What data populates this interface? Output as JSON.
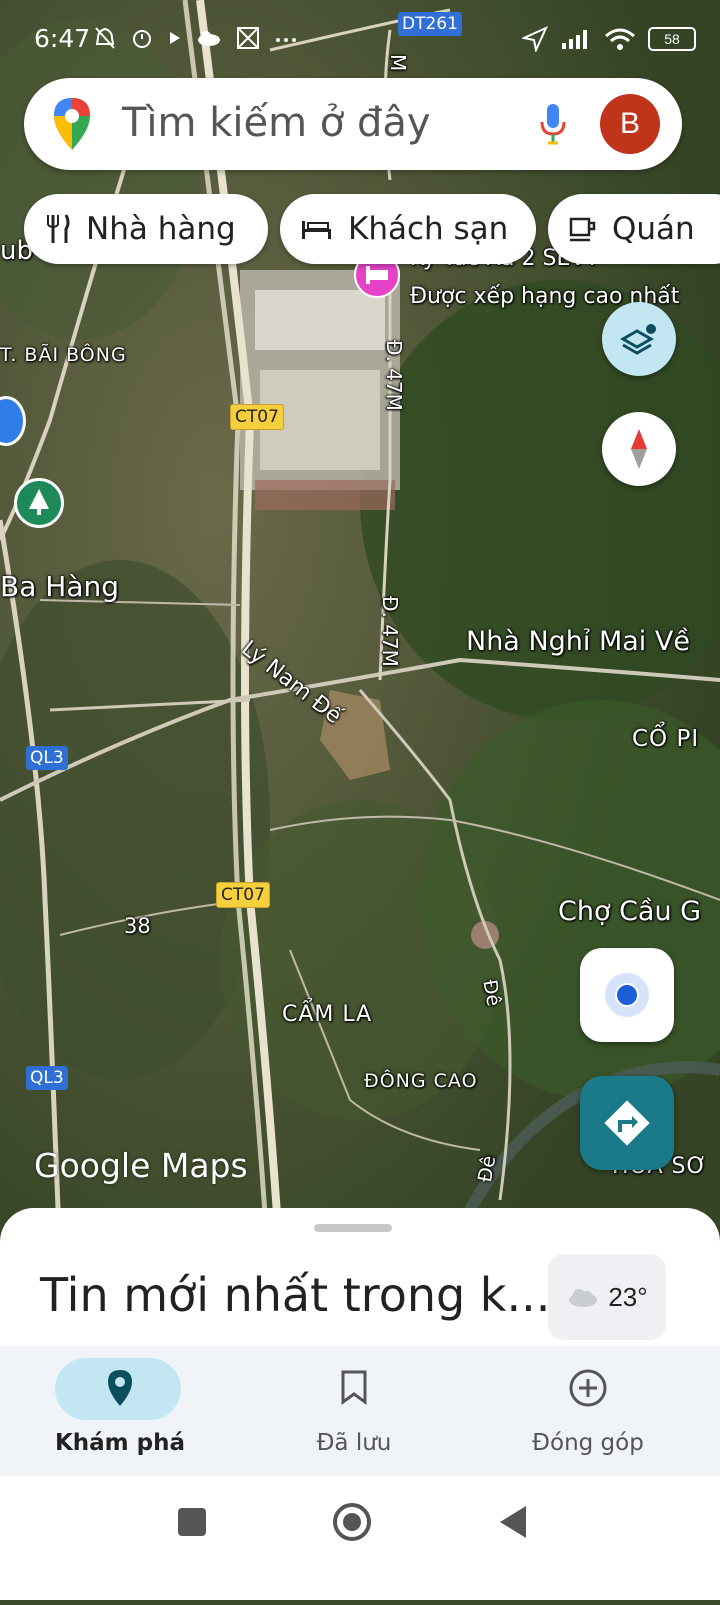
{
  "status": {
    "time": "6:47",
    "battery": "58",
    "left_icons": [
      "bell-off-icon",
      "alarm-icon",
      "play-icon",
      "cloud-icon",
      "image-icon",
      "more-dots-icon"
    ],
    "right_icons": [
      "location-arrow-icon",
      "signal-icon",
      "wifi-icon",
      "battery-icon"
    ]
  },
  "search": {
    "placeholder": "Tìm kiếm ở đây",
    "avatar_letter": "B",
    "avatar_color": "#c0341b"
  },
  "chips": [
    {
      "label": "Nhà hàng",
      "icon": "fork-knife-icon"
    },
    {
      "label": "Khách sạn",
      "icon": "bed-icon"
    },
    {
      "label": "Quán",
      "icon": "cup-icon"
    }
  ],
  "map": {
    "labels": {
      "ub": "ub",
      "bai_bong": "T. BÃI BÔNG",
      "ba_hang": "Ba Hàng",
      "ly_nam_de": "Lý Nam Đế",
      "d47m_1": "Đ. 47M",
      "d47m_2": "Đ. 47M",
      "m_top": "M",
      "nha_nghi": "Nhà Nghỉ Mai Về",
      "co_p": "CỔ PI",
      "cho_cau": "Chợ Cầu G",
      "cam_la": "CẨM LA",
      "dong_cao": "ĐÔNG CAO",
      "hoa_so": "HOÀ SƠ",
      "de_1": "Đê",
      "de_2": "Đê",
      "num_38": "38",
      "poi_title": "Ký Túc Xá 2 SEVT",
      "poi_sub": "Được xếp hạng cao nhất"
    },
    "shields": {
      "dt261": "DT261",
      "ct07_1": "CT07",
      "ct07_2": "CT07",
      "ql3_1": "QL3",
      "ql3_2": "QL3"
    },
    "watermark": "Google Maps"
  },
  "sheet": {
    "title": "Tin mới nhất trong k...",
    "temperature": "23°"
  },
  "nav": [
    {
      "label": "Khám phá",
      "icon": "location-pin-icon",
      "active": true
    },
    {
      "label": "Đã lưu",
      "icon": "bookmark-icon",
      "active": false
    },
    {
      "label": "Đóng góp",
      "icon": "add-circle-icon",
      "active": false
    }
  ],
  "colors": {
    "accent_teal": "#1a7a8a",
    "active_pill": "#c2e7f2",
    "active_icon": "#0b4f5f"
  }
}
